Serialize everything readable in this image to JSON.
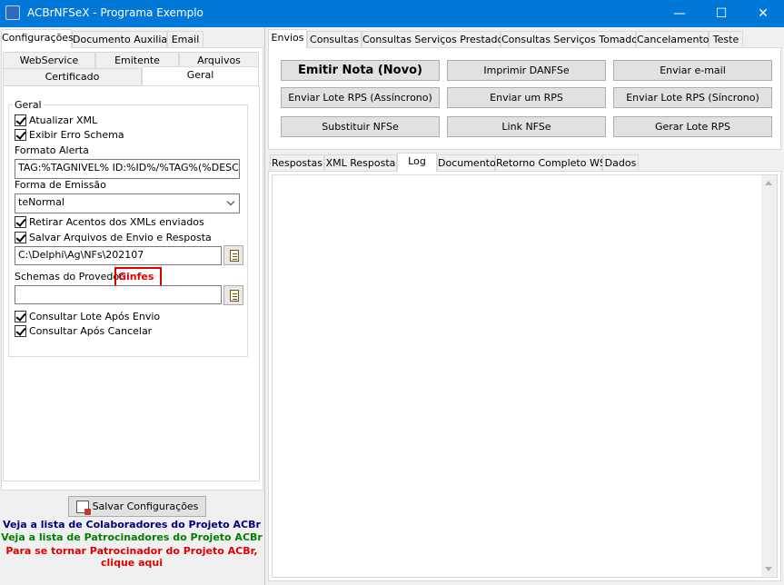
{
  "window": {
    "title": "ACBrNFSeX - Programa Exemplo",
    "minimize": "—",
    "maximize": "☐",
    "close": "✕"
  },
  "left": {
    "tabs": [
      "Configurações",
      "Documento Auxiliar",
      "Email"
    ],
    "subtabs_row1": [
      "WebService",
      "Emitente",
      "Arquivos"
    ],
    "subtabs_row2": [
      "Certificado",
      "Geral"
    ],
    "group_title": "Geral",
    "atualizar_xml": "Atualizar XML",
    "exibir_erro": "Exibir Erro Schema",
    "formato_alerta_label": "Formato Alerta",
    "formato_alerta_value": "TAG:%TAGNIVEL% ID:%ID%/%TAG%(%DESCRI",
    "forma_emissao_label": "Forma de Emissão",
    "forma_emissao_value": "teNormal",
    "retirar_acentos": "Retirar Acentos dos XMLs enviados",
    "salvar_arquivos": "Salvar Arquivos de Envio e Resposta",
    "path_value": "C:\\Delphi\\Ag\\NFs\\202107",
    "schemas_label": "Schemas do Provedor:",
    "schemas_provider": "Ginfes",
    "schemas_value": "",
    "consultar_lote": "Consultar Lote Após Envio",
    "consultar_cancelar": "Consultar Após Cancelar",
    "save_button": "Salvar Configurações",
    "link_colaboradores": "Veja a lista de Colaboradores do Projeto ACBr",
    "link_patrocinadores": "Veja a lista de Patrocinadores do Projeto ACBr",
    "link_patrocinador_1": "Para se tornar Patrocinador do Projeto ACBr,",
    "link_patrocinador_2": "clique aqui"
  },
  "right": {
    "tabs": [
      "Envios",
      "Consultas",
      "Consultas Serviços Prestados",
      "Consultas Serviços Tomados",
      "Cancelamento",
      "Teste"
    ],
    "buttons": [
      "Emitir Nota (Novo)",
      "Imprimir DANFSe",
      "Enviar e-mail",
      "Enviar Lote RPS (Assíncrono)",
      "Enviar um RPS",
      "Enviar Lote RPS (Síncrono)",
      "Substituir NFSe",
      "Link NFSe",
      "Gerar Lote RPS"
    ],
    "bottom_tabs": [
      "Respostas",
      "XML Resposta",
      "Log",
      "Documento",
      "Retorno Completo WS",
      "Dados"
    ],
    "log_text": ""
  },
  "colors": {
    "titlebar": "#0078d7",
    "highlight": "#e00000",
    "link_blue": "#00007f",
    "link_green": "#007f00",
    "link_red": "#e00000"
  }
}
